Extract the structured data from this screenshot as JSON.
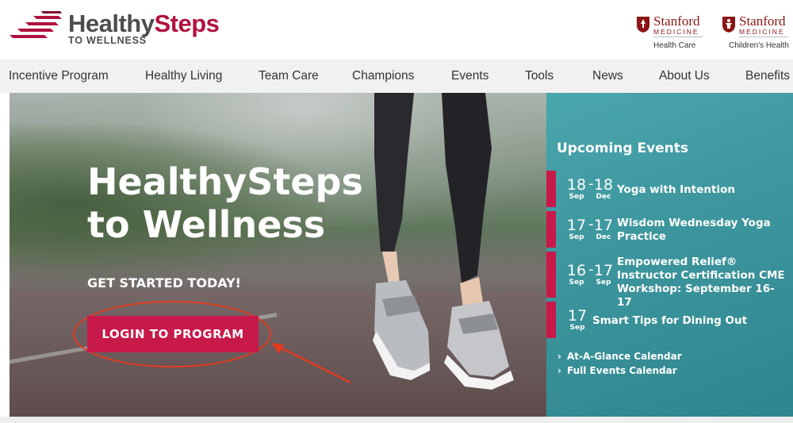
{
  "brand": {
    "name_part1": "Healthy",
    "name_part2": "Steps",
    "tagline": "TO WELLNESS"
  },
  "partners": [
    {
      "name": "Stanford",
      "division": "MEDICINE",
      "sub": "Health Care"
    },
    {
      "name": "Stanford",
      "division": "MEDICINE",
      "sub": "Children's Health"
    }
  ],
  "nav": [
    "Incentive Program",
    "Healthy Living",
    "Team Care",
    "Champions",
    "Events",
    "Tools",
    "News",
    "About Us",
    "Benefits"
  ],
  "hero": {
    "title_line1": "HealthySteps",
    "title_line2": "to Wellness",
    "subtitle": "GET STARTED TODAY!",
    "button_label": "LOGIN TO PROGRAM"
  },
  "events": {
    "heading": "Upcoming Events",
    "items": [
      {
        "day_start": "18",
        "month_start": "Sep",
        "day_end": "18",
        "month_end": "Dec",
        "title": "Yoga with Intention"
      },
      {
        "day_start": "17",
        "month_start": "Sep",
        "day_end": "17",
        "month_end": "Dec",
        "title": "Wisdom Wednesday Yoga Practice"
      },
      {
        "day_start": "16",
        "month_start": "Sep",
        "day_end": "17",
        "month_end": "Sep",
        "title": "Empowered Relief® Instructor Certification CME Workshop: September 16-17"
      },
      {
        "day_start": "17",
        "month_start": "Sep",
        "title": "Smart Tips for Dining Out"
      }
    ],
    "links": [
      "At-A-Glance Calendar",
      "Full Events Calendar"
    ]
  },
  "colors": {
    "brand_red": "#c8194b",
    "stanford_red": "#8c1515",
    "events_teal": "#3e979f",
    "annotation": "#e23b1f"
  }
}
